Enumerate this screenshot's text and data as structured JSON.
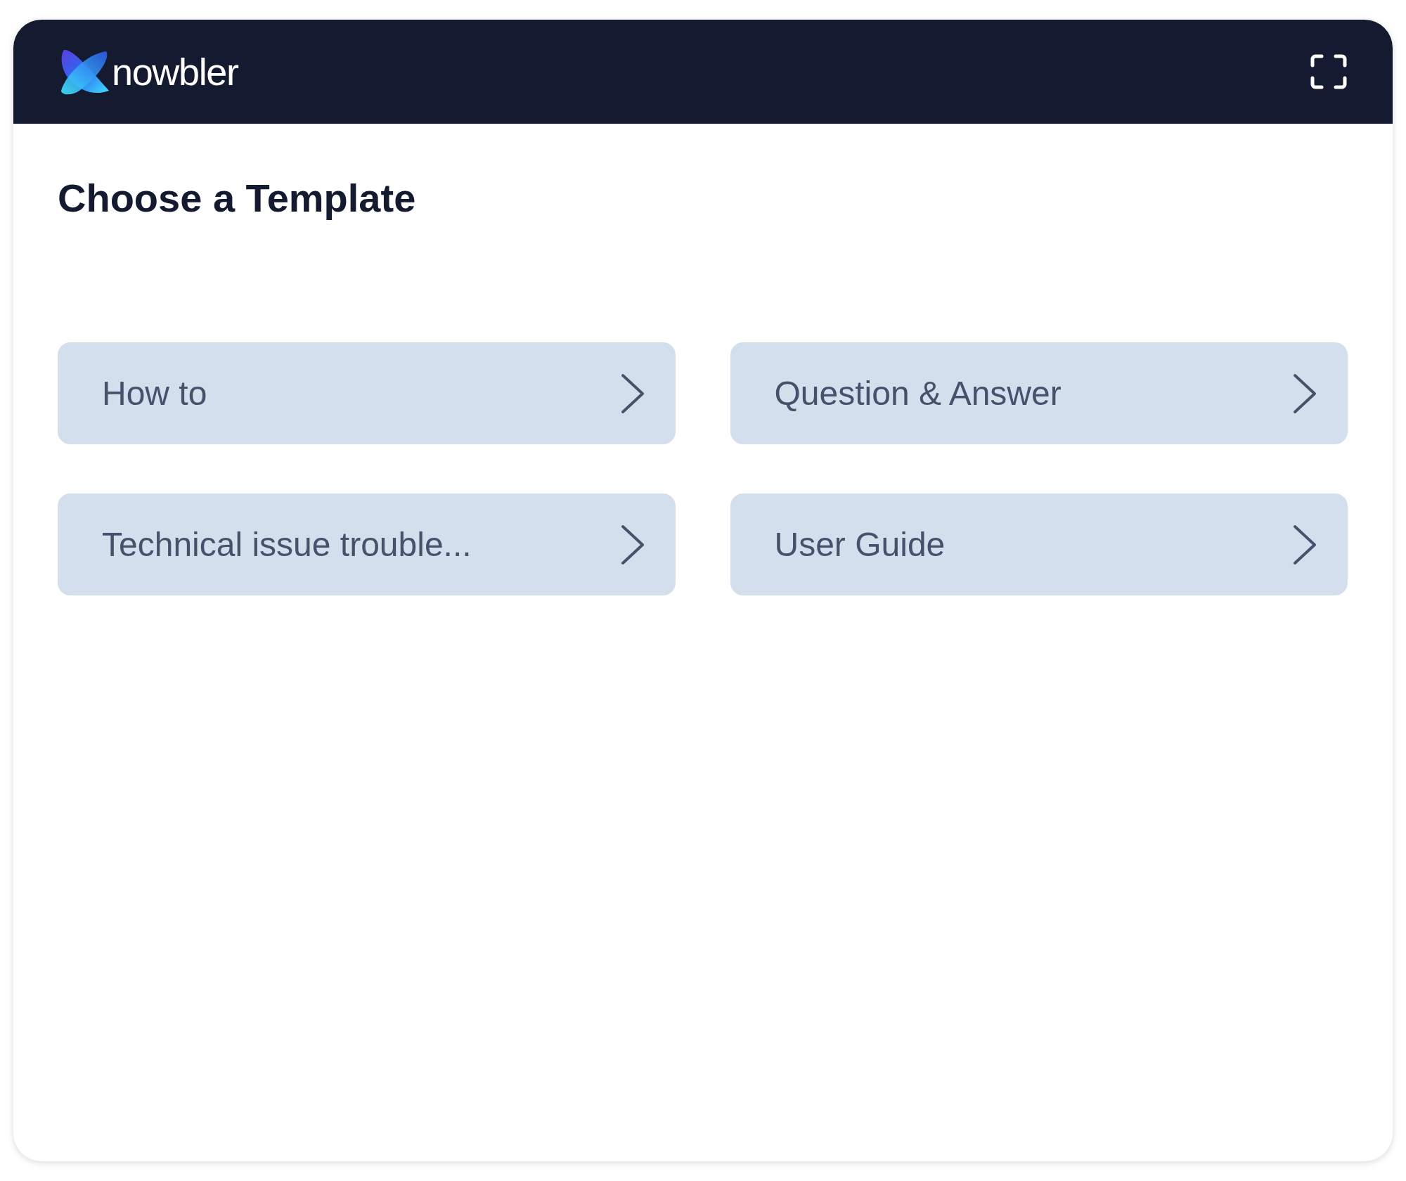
{
  "header": {
    "logo_text": "nowbler"
  },
  "title": "Choose a Template",
  "templates": [
    {
      "label": "How to"
    },
    {
      "label": "Question & Answer"
    },
    {
      "label": "Technical issue trouble..."
    },
    {
      "label": "User Guide"
    }
  ]
}
